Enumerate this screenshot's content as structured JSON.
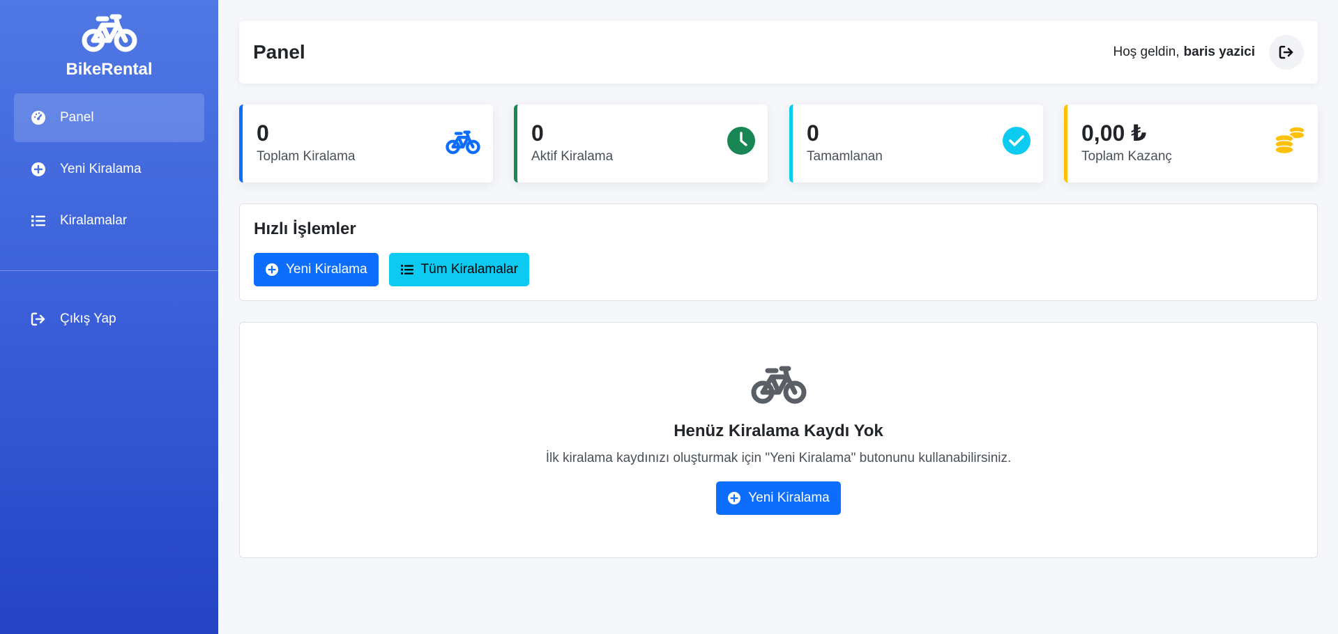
{
  "sidebar": {
    "brand": "BikeRental",
    "items": [
      {
        "label": "Panel",
        "icon": "gauge-icon",
        "active": true
      },
      {
        "label": "Yeni Kiralama",
        "icon": "plus-circle-icon",
        "active": false
      },
      {
        "label": "Kiralamalar",
        "icon": "list-icon",
        "active": false
      }
    ],
    "logout_label": "Çıkış Yap"
  },
  "header": {
    "title": "Panel",
    "welcome_text": "Hoş geldin,",
    "username": "baris yazici"
  },
  "stats": [
    {
      "value": "0",
      "label": "Toplam Kiralama",
      "icon": "bicycle-icon",
      "color": "#0d6efd"
    },
    {
      "value": "0",
      "label": "Aktif Kiralama",
      "icon": "clock-icon",
      "color": "#198754"
    },
    {
      "value": "0",
      "label": "Tamamlanan",
      "icon": "check-circle-icon",
      "color": "#0dcaf0"
    },
    {
      "value": "0,00 ₺",
      "label": "Toplam Kazanç",
      "icon": "coins-icon",
      "color": "#ffc107"
    }
  ],
  "quick_actions": {
    "title": "Hızlı İşlemler",
    "new_rental_label": "Yeni Kiralama",
    "all_rentals_label": "Tüm Kiralamalar"
  },
  "empty_state": {
    "title": "Henüz Kiralama Kaydı Yok",
    "description": "İlk kiralama kaydınızı oluşturmak için \"Yeni Kiralama\" butonunu kullanabilirsiniz.",
    "button_label": "Yeni Kiralama"
  },
  "colors": {
    "primary": "#0d6efd",
    "info": "#0dcaf0",
    "success": "#198754",
    "warning": "#ffc107",
    "sidebar_top": "#4f78e4",
    "sidebar_bottom": "#2343c4"
  }
}
